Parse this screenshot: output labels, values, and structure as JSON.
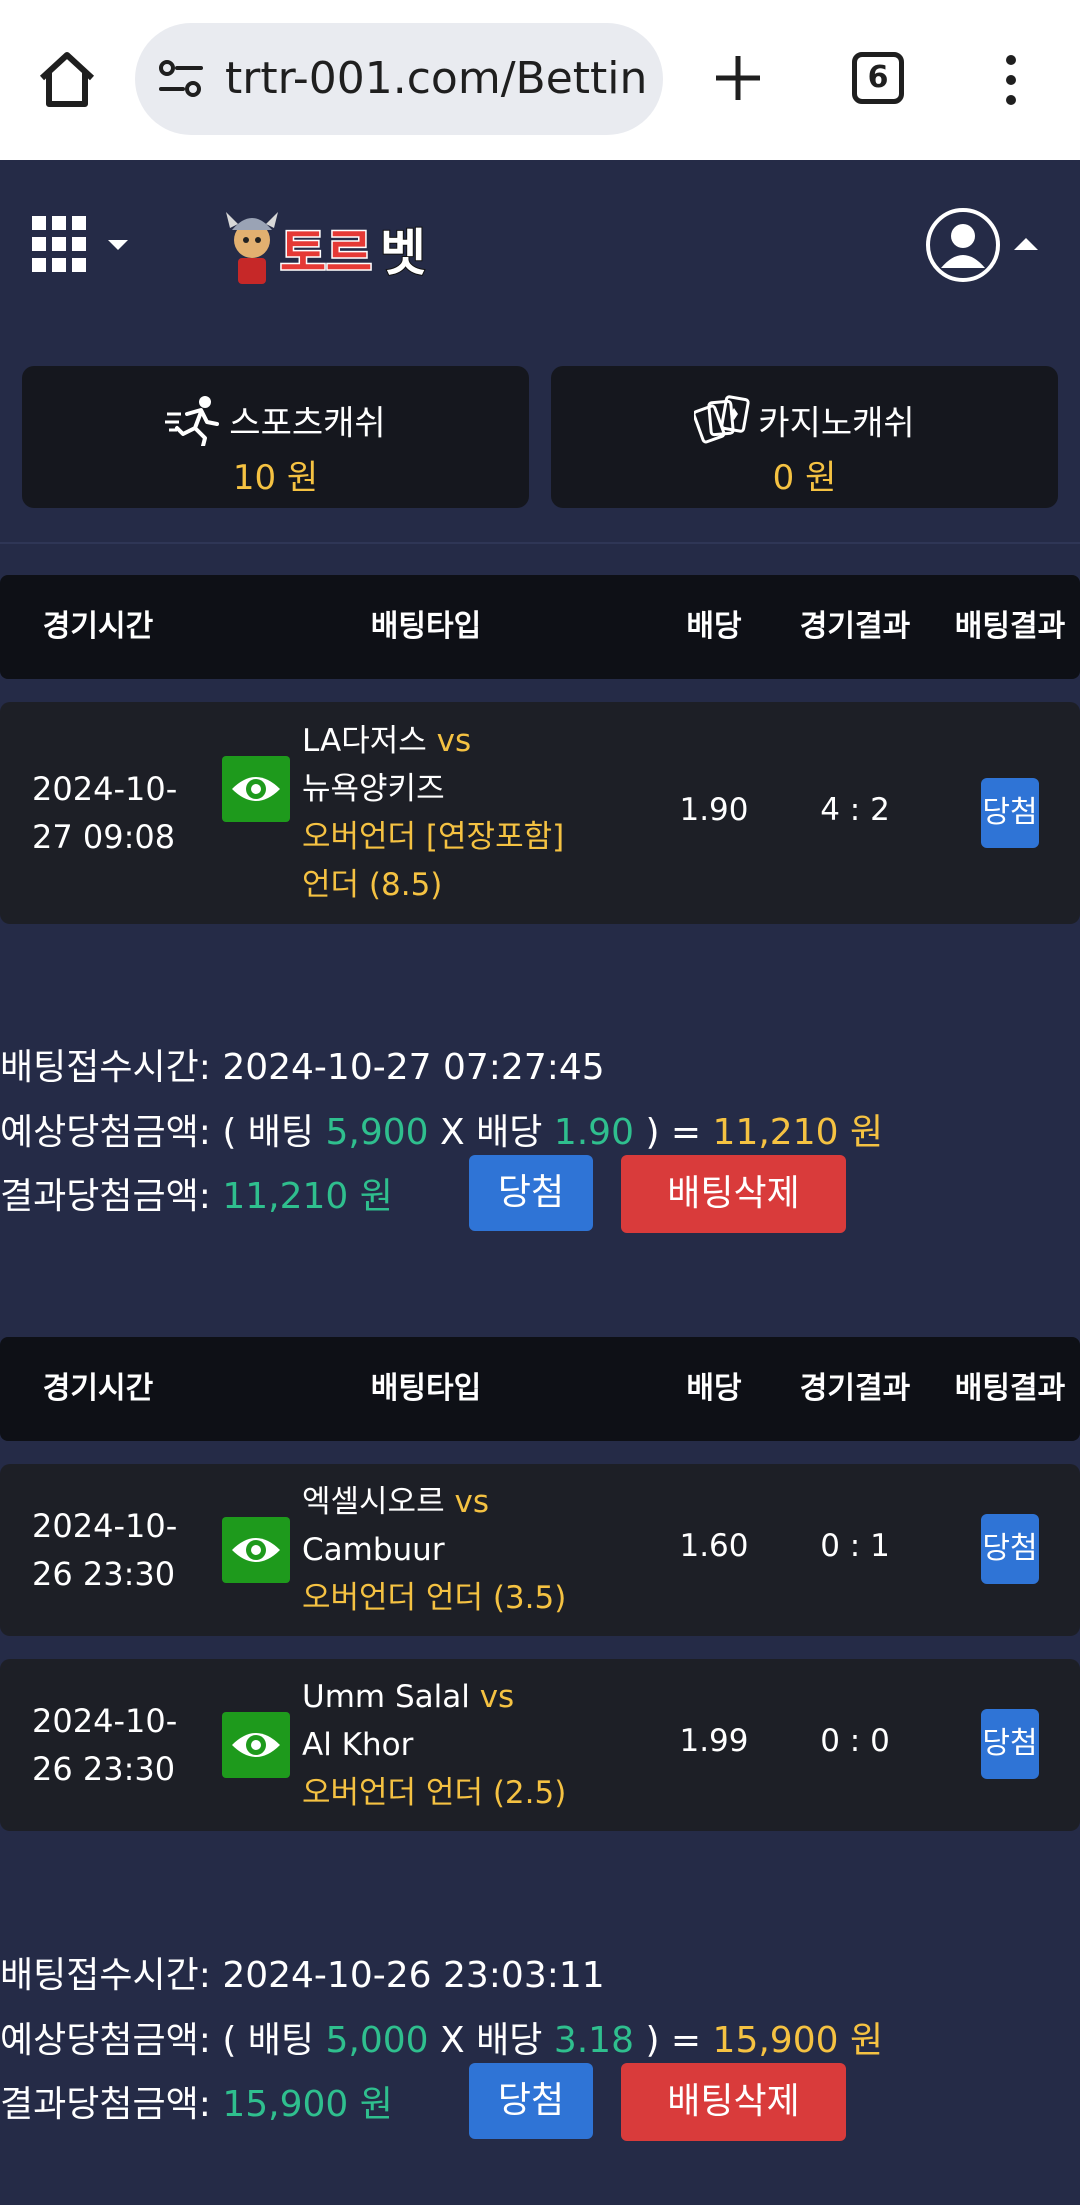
{
  "browser": {
    "url": "trtr-001.com/Betting",
    "tab_count": "6"
  },
  "header": {
    "logo_text": "토르벳"
  },
  "cash": {
    "sports_label": "스포츠캐쉬",
    "sports_value": "10 원",
    "casino_label": "카지노캐쉬",
    "casino_value": "0 원"
  },
  "columns": {
    "time": "경기시간",
    "type": "배팅타입",
    "odds": "배당",
    "game_result": "경기결과",
    "bet_result": "배팅결과"
  },
  "bets": [
    {
      "rows": [
        {
          "date_line1": "2024-10-",
          "date_line2": "27 09:08",
          "home": "LA다저스",
          "vs": "vs",
          "away": "뉴욕양키즈",
          "bet_line1": "오버언더 [연장포함]",
          "bet_line2": "언더 (8.5)",
          "odds": "1.90",
          "score": "4 : 2",
          "result": "당첨"
        }
      ],
      "summary": {
        "time_label": "배팅접수시간:",
        "time_value": "2024-10-27 07:27:45",
        "expected_label": "예상당첨금액:",
        "open_paren": "( 배팅",
        "stake": "5,900",
        "x_label": "X 배당",
        "total_odds": "1.90",
        "close_paren": ") =",
        "expected_amount": "11,210 원",
        "result_label": "결과당첨금액:",
        "result_amount": "11,210 원",
        "win_button": "당첨",
        "delete_button": "배팅삭제"
      }
    },
    {
      "rows": [
        {
          "date_line1": "2024-10-",
          "date_line2": "26 23:30",
          "home": "엑셀시오르",
          "vs": "vs",
          "away": "Cambuur",
          "bet_line1": "오버언더 언더 (3.5)",
          "odds": "1.60",
          "score": "0 : 1",
          "result": "당첨"
        },
        {
          "date_line1": "2024-10-",
          "date_line2": "26 23:30",
          "home": "Umm Salal",
          "vs": "vs",
          "away": "Al Khor",
          "bet_line1": "오버언더 언더 (2.5)",
          "odds": "1.99",
          "score": "0 : 0",
          "result": "당첨"
        }
      ],
      "summary": {
        "time_label": "배팅접수시간:",
        "time_value": "2024-10-26 23:03:11",
        "expected_label": "예상당첨금액:",
        "open_paren": "( 배팅",
        "stake": "5,000",
        "x_label": "X 배당",
        "total_odds": "3.18",
        "close_paren": ") =",
        "expected_amount": "15,900 원",
        "result_label": "결과당첨금액:",
        "result_amount": "15,900 원",
        "win_button": "당첨",
        "delete_button": "배팅삭제"
      }
    }
  ],
  "colors": {
    "page_bg": "#252b47",
    "accent_yellow": "#f5c242",
    "accent_green": "#2fbf8e",
    "win_blue": "#2f74d6",
    "delete_red": "#d93b3b"
  }
}
